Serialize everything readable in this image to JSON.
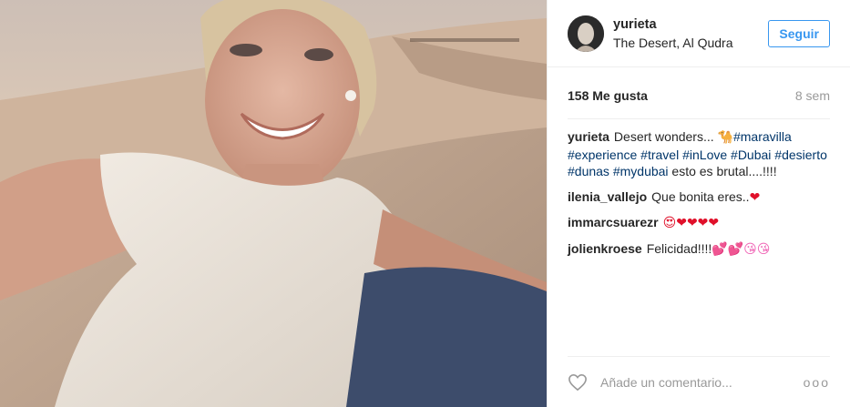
{
  "photo": {
    "alt_icon": "selfie-photo"
  },
  "header": {
    "username": "yurieta",
    "location": "The Desert, Al Qudra",
    "follow_label": "Seguir"
  },
  "stats": {
    "likes": "158 Me gusta",
    "age": "8 sem"
  },
  "caption": {
    "user": "yurieta",
    "text_before": "Desert wonders... ",
    "emoji": "🐪",
    "tags": [
      "#maravilla",
      "#experience",
      "#travel",
      "#inLove",
      "#Dubai",
      "#desierto",
      "#dunas",
      "#mydubai"
    ],
    "text_after": "esto es brutal....!!!!"
  },
  "comments": [
    {
      "user": "ilenia_vallejo",
      "text": "Que bonita eres..",
      "emoji": "❤"
    },
    {
      "user": "immarcsuarezr",
      "text": "",
      "emoji": "😍❤❤❤❤"
    },
    {
      "user": "jolienkroese",
      "text": "Felicidad!!!!",
      "emoji": "💕💕😘😘"
    }
  ],
  "footer": {
    "placeholder": "Añade un comentario...",
    "more": "ooo"
  },
  "colors": {
    "accent": "#3897f0",
    "hashtag": "#003569",
    "muted": "#999999"
  }
}
